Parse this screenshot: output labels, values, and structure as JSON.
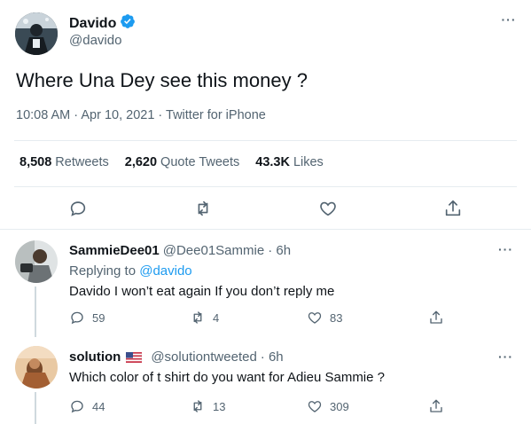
{
  "main_tweet": {
    "author_name": "Davido",
    "author_handle": "@davido",
    "text": "Where Una Dey see this money ?",
    "meta": "10:08 AM · Apr 10, 2021 · Twitter for iPhone",
    "stats": {
      "retweets_count": "8,508",
      "retweets_label": "Retweets",
      "quotes_count": "2,620",
      "quotes_label": "Quote Tweets",
      "likes_count": "43.3K",
      "likes_label": "Likes"
    }
  },
  "replies": [
    {
      "name": "SammieDee01",
      "handle": "@Dee01Sammie",
      "time": "· 6h",
      "replying_prefix": "Replying to",
      "replying_to": "@davido",
      "text": "Davido I won’t eat again If you don’t reply me",
      "reply_count": "59",
      "retweet_count": "4",
      "like_count": "83"
    },
    {
      "name": "solution",
      "handle": "@solutiontweeted",
      "time": "· 6h",
      "text": "Which color of t shirt do you want for Adieu Sammie ?",
      "reply_count": "44",
      "retweet_count": "13",
      "like_count": "309"
    }
  ],
  "more_glyph": "···",
  "colors": {
    "accent": "#1d9bf0",
    "secondary_text": "#536471",
    "primary_text": "#0f1419",
    "divider": "#e6ecf0"
  },
  "icons": [
    "verified-badge-icon",
    "reply-icon",
    "retweet-icon",
    "like-icon",
    "share-icon",
    "more-icon",
    "us-flag-icon"
  ]
}
